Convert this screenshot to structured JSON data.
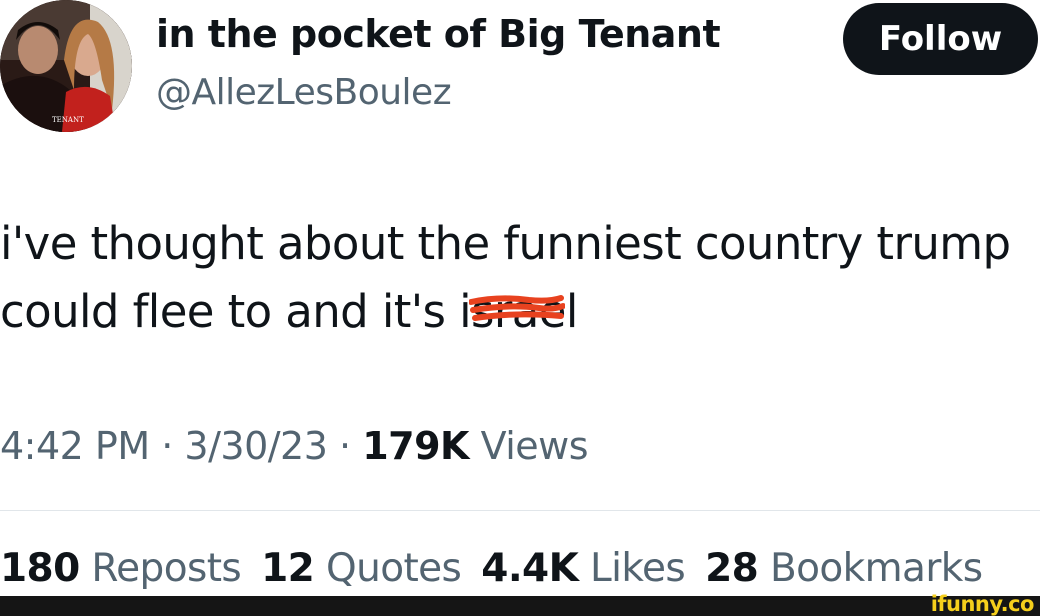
{
  "header": {
    "display_name": "in the pocket of Big Tenant",
    "handle": "@AllezLesBoulez",
    "follow_label": "Follow",
    "avatar_caption": "TENANT"
  },
  "tweet": {
    "line1": "i've thought about the funniest country trump",
    "line2_prefix": "could flee to and it's i",
    "line2_scribbled": "srae",
    "line2_suffix": "l",
    "scribble_color": "#e8421f"
  },
  "meta": {
    "time": "4:42 PM",
    "sep1": "·",
    "date": "3/30/23",
    "sep2": "·",
    "views_count": "179K",
    "views_label": "Views"
  },
  "stats": {
    "reposts_count": "180",
    "reposts_label": "Reposts",
    "quotes_count": "12",
    "quotes_label": "Quotes",
    "likes_count": "4.4K",
    "likes_label": "Likes",
    "bookmarks_count": "28",
    "bookmarks_label": "Bookmarks"
  },
  "watermark": "ifunny.co",
  "colors": {
    "text": "#0f1419",
    "muted": "#536471",
    "follow_bg": "#0f1419",
    "watermark": "#f5cf1c"
  }
}
